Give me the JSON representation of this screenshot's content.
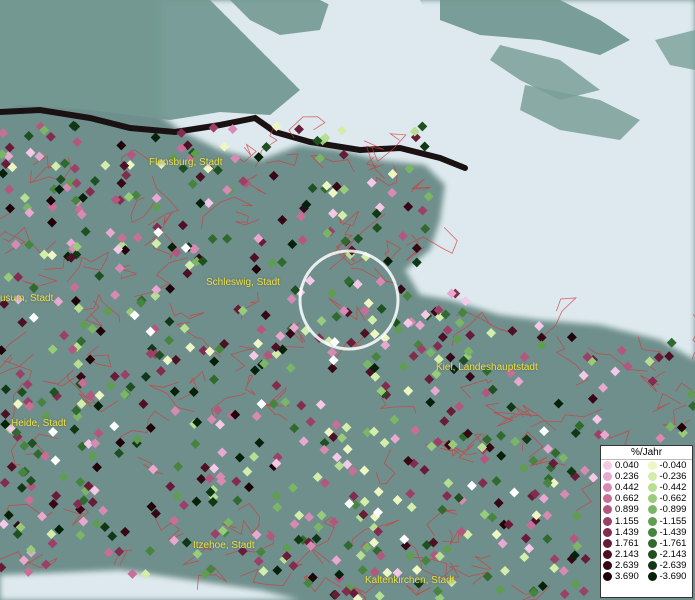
{
  "map": {
    "cities": [
      {
        "name": "Flensburg, Stadt"
      },
      {
        "name": "Schleswig, Stadt"
      },
      {
        "name": "usum, Stadt"
      },
      {
        "name": "Kiel, Landeshauptstadt"
      },
      {
        "name": "Heide, Stadt"
      },
      {
        "name": "Itzehoe, Stadt"
      },
      {
        "name": "Kaltenkirchen, Stadt"
      }
    ],
    "colors": {
      "water": "#dde9ee",
      "land": "#6f8f8c",
      "border": "#1a1212",
      "municipality_lines": "#d23a3a",
      "label": "#e8e23a"
    }
  },
  "legend": {
    "title": "%/Jahr",
    "positive": [
      {
        "label": "0.040",
        "color": "#f5c8e8"
      },
      {
        "label": "0.236",
        "color": "#e8a8cf"
      },
      {
        "label": "0.442",
        "color": "#d98ab3"
      },
      {
        "label": "0.662",
        "color": "#c86f98"
      },
      {
        "label": "0.899",
        "color": "#b3577f"
      },
      {
        "label": "1.155",
        "color": "#9b4066"
      },
      {
        "label": "1.439",
        "color": "#822c4e"
      },
      {
        "label": "1.761",
        "color": "#681c38"
      },
      {
        "label": "2.143",
        "color": "#4e1025"
      },
      {
        "label": "2.639",
        "color": "#360816"
      },
      {
        "label": "3.690",
        "color": "#200308"
      }
    ],
    "negative": [
      {
        "label": "-0.040",
        "color": "#eef7c4"
      },
      {
        "label": "-0.236",
        "color": "#d3edaa"
      },
      {
        "label": "-0.442",
        "color": "#b6df92"
      },
      {
        "label": "-0.662",
        "color": "#98cc7b"
      },
      {
        "label": "-0.899",
        "color": "#7bb666"
      },
      {
        "label": "-1.155",
        "color": "#5f9d51"
      },
      {
        "label": "-1.439",
        "color": "#46843f"
      },
      {
        "label": "-1.761",
        "color": "#306a2f"
      },
      {
        "label": "-2.143",
        "color": "#1f5021"
      },
      {
        "label": "-2.639",
        "color": "#103816"
      },
      {
        "label": "-3.690",
        "color": "#05210a"
      }
    ]
  }
}
